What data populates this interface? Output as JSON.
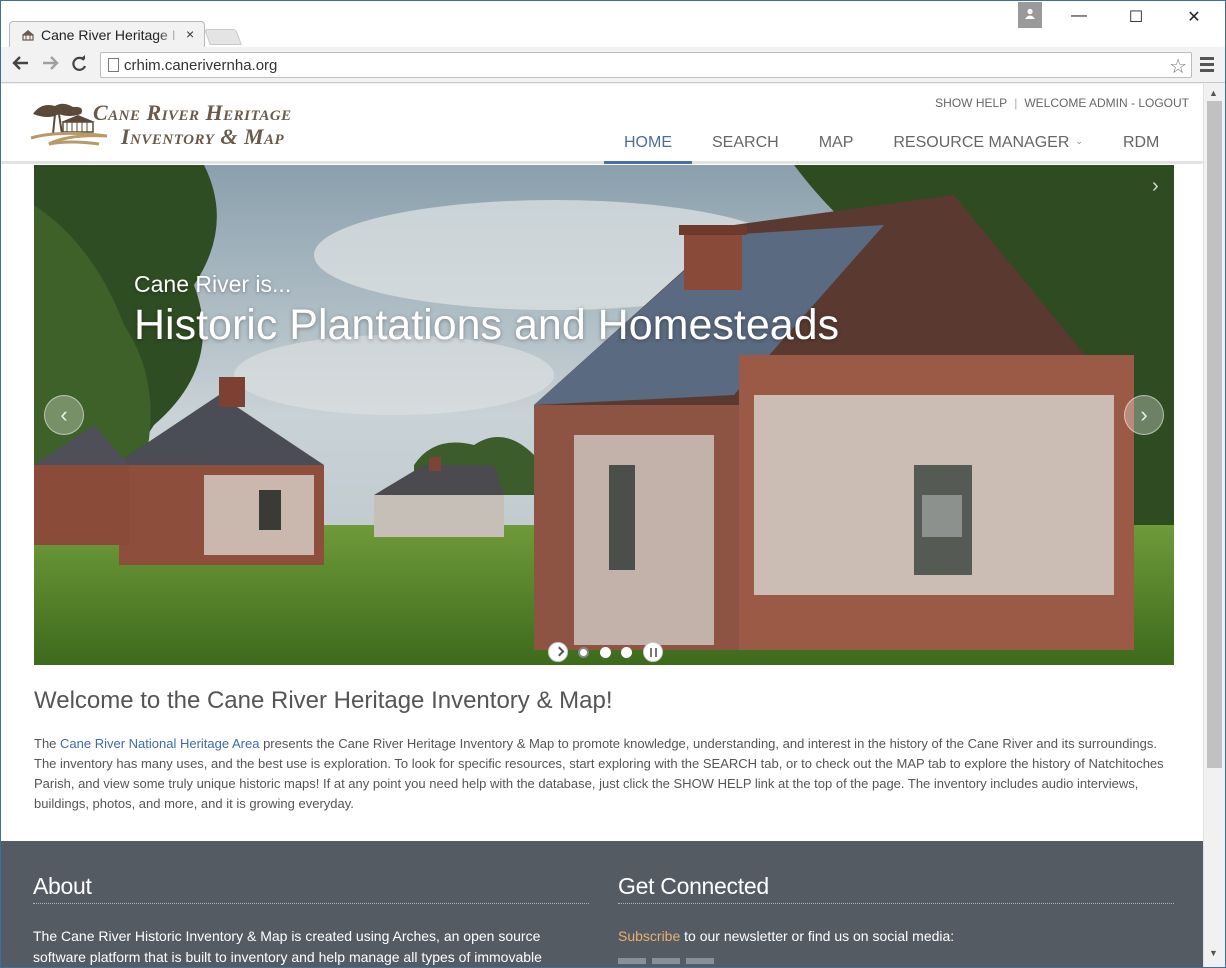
{
  "browser": {
    "tab_title": "Cane River Heritage I",
    "url": "crhim.canerivernha.org",
    "back_icon": "arrow-left-icon",
    "forward_icon": "arrow-right-icon",
    "reload_icon": "reload-icon",
    "bookmark_icon": "star-icon",
    "menu_icon": "hamburger-menu-icon",
    "close_symbol": "✕",
    "minimize_symbol": "—",
    "maximize_symbol": "☐",
    "tab_close_symbol": "×"
  },
  "site": {
    "logo_line1": "Cane River Heritage",
    "logo_line2": "Inventory & Map",
    "util": {
      "show_help": "SHOW HELP",
      "separator": "|",
      "welcome": "WELCOME ADMIN - LOGOUT"
    },
    "nav": [
      {
        "label": "HOME",
        "active": true
      },
      {
        "label": "SEARCH",
        "active": false
      },
      {
        "label": "MAP",
        "active": false
      },
      {
        "label": "RESOURCE MANAGER",
        "active": false,
        "dropdown": true
      },
      {
        "label": "RDM",
        "active": false
      }
    ]
  },
  "hero": {
    "kicker": "Cane River is...",
    "title": "Historic Plantations and Homesteads",
    "slide_count": 3,
    "active_slide": 1,
    "prev_symbol": "‹",
    "next_symbol": "›"
  },
  "welcome": {
    "title": "Welcome to the Cane River Heritage Inventory & Map!",
    "body_prefix": "The ",
    "body_link": "Cane River National Heritage Area",
    "body_rest": " presents the Cane River Heritage Inventory & Map to promote knowledge, understanding, and interest in the history of the Cane River and its surroundings. The inventory has many uses, and the best use is exploration. To look for specific resources, start exploring with the SEARCH tab, or to check out the MAP tab to explore the history of Natchitoches Parish, and view some truly unique historic maps! If at any point you need help with the database, just click the SHOW HELP link at the top of the page. The inventory includes audio interviews, buildings, photos, and more, and it is growing everyday."
  },
  "footer": {
    "about_heading": "About",
    "about_text": "The Cane River Historic Inventory & Map is created using Arches, an open source software platform that is built to inventory and help manage all types of immovable",
    "connect_heading": "Get Connected",
    "connect_link": "Subscribe",
    "connect_text": " to our newsletter or find us on social media:"
  },
  "colors": {
    "nav_active": "#4a6ea0",
    "link": "#3f6ba8",
    "footer_bg": "#555b63",
    "footer_link": "#e7b16e",
    "logo_brown": "#6a5a4b"
  }
}
